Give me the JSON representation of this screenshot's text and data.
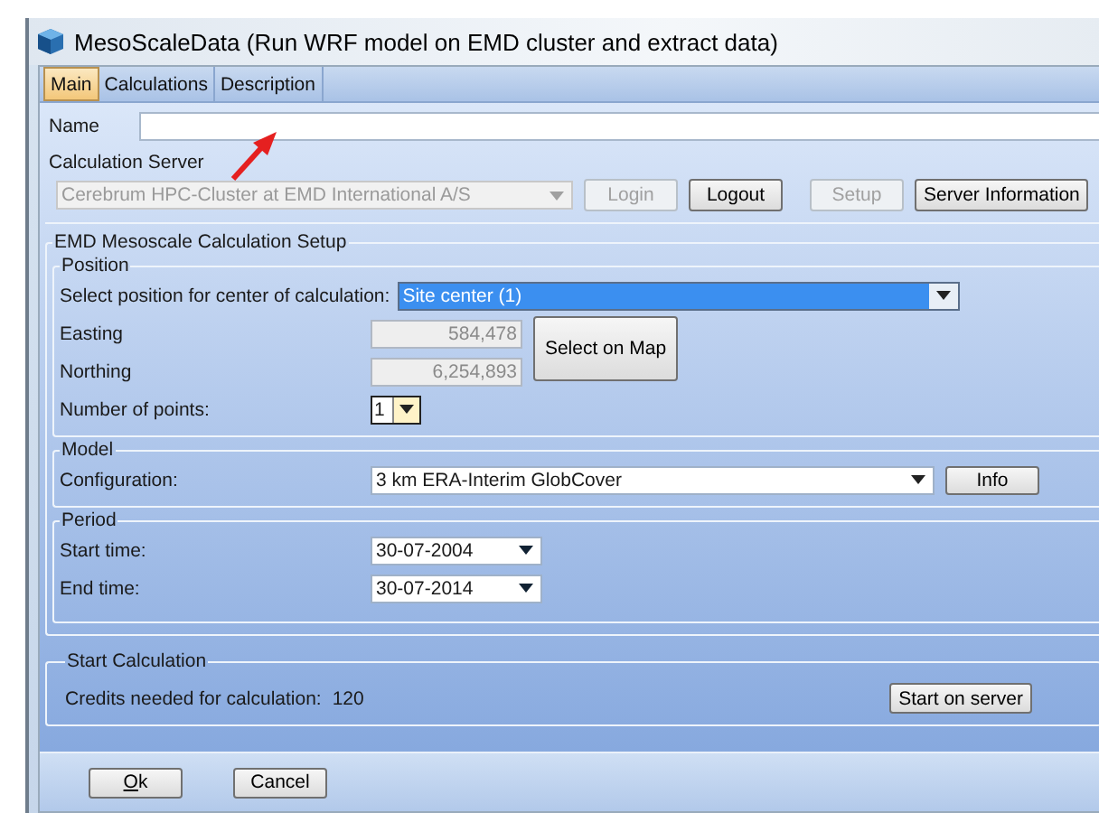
{
  "window": {
    "title": "MesoScaleData (Run WRF model on EMD cluster and extract data)"
  },
  "tabs": [
    {
      "label": "Main",
      "selected": true
    },
    {
      "label": "Calculations",
      "selected": false
    },
    {
      "label": "Description",
      "selected": false
    }
  ],
  "name_field": {
    "label": "Name"
  },
  "calculation_server": {
    "title": "Calculation Server",
    "server": {
      "value": "Cerebrum HPC-Cluster at EMD International A/S",
      "disabled": true
    },
    "buttons": [
      {
        "label": "Login",
        "disabled": true
      },
      {
        "label": "Logout",
        "disabled": false
      },
      {
        "label": "Setup",
        "disabled": true
      },
      {
        "label": "Server Information",
        "disabled": false
      }
    ]
  },
  "setup": {
    "title": "EMD Mesoscale Calculation Setup",
    "position": {
      "title": "Position",
      "select_label": "Select position for center of calculation:",
      "select_value": "Site center (1)",
      "easting_label": "Easting",
      "easting": "584,478",
      "northing_label": "Northing",
      "northing": "6,254,893",
      "coords_disabled": true,
      "map_button": "Select on Map",
      "points_label": "Number of points:",
      "points": "1"
    },
    "model": {
      "title": "Model",
      "config_label": "Configuration:",
      "config_value": "3 km ERA-Interim GlobCover",
      "info_button": "Info"
    },
    "period": {
      "title": "Period",
      "start_label": "Start time:",
      "start": "30-07-2004",
      "end_label": "End time:",
      "end": "30-07-2014"
    }
  },
  "start_calculation": {
    "title": "Start Calculation",
    "credits_label": "Credits needed for calculation:",
    "credits": "120",
    "button": "Start on server"
  },
  "footer": {
    "ok": "Ok",
    "cancel": "Cancel"
  }
}
